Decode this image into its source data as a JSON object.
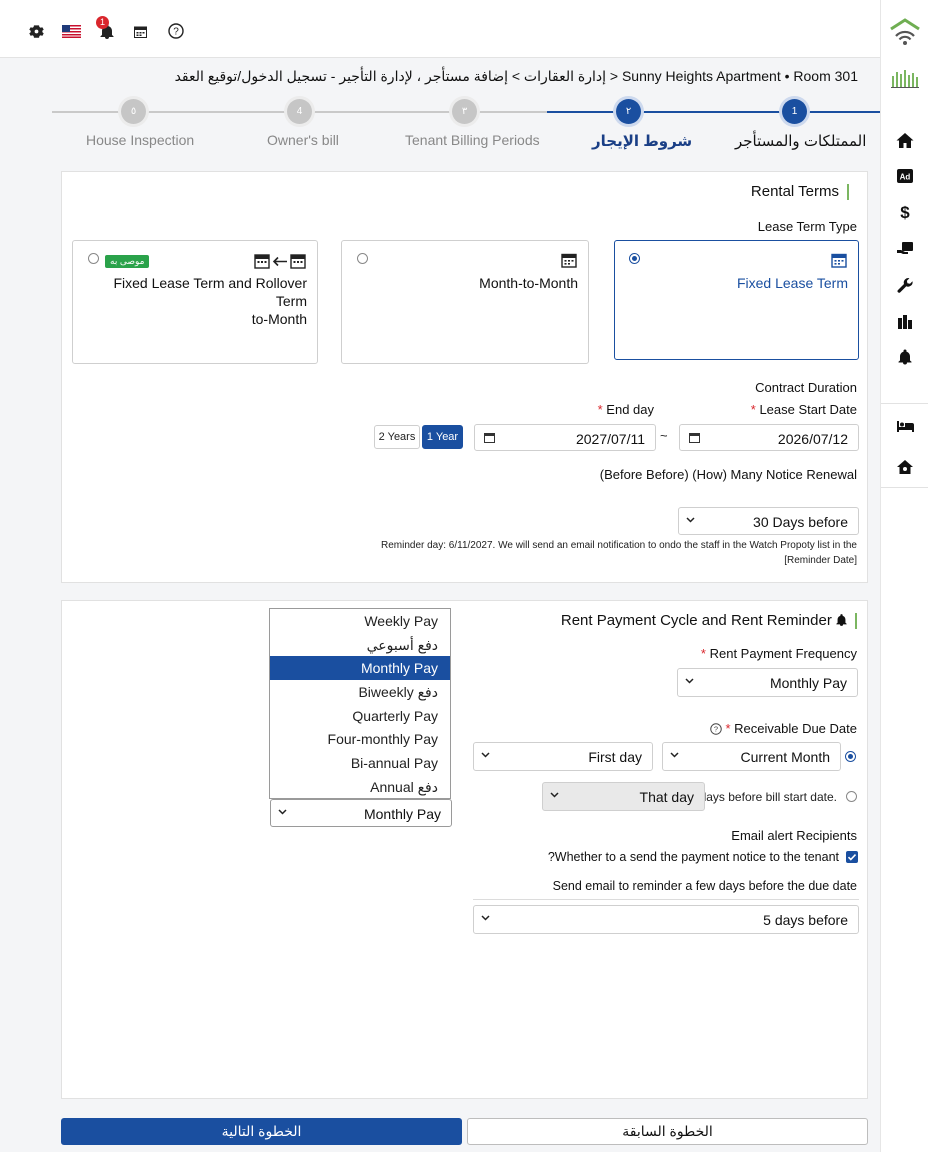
{
  "topbar": {
    "notification_count": "1",
    "icons": [
      "gear-icon",
      "us-flag-icon",
      "bell-icon",
      "calendar-icon",
      "help-icon"
    ]
  },
  "breadcrumb": "Sunny Heights Apartment • Room 301 < إدارة العقارات > إضافة مستأجر ، لإدارة التأجير - تسجيل الدخول/توقيع العقد",
  "stepper": {
    "steps": [
      {
        "number": "1",
        "label": "الممتلكات والمستأجر",
        "state": "done"
      },
      {
        "number": "٢",
        "label": "شروط الإيجار",
        "state": "current"
      },
      {
        "number": "٣",
        "label": "Tenant Billing Periods",
        "state": "todo"
      },
      {
        "number": "4",
        "label": "Owner's bill",
        "state": "todo"
      },
      {
        "number": "٥",
        "label": "House Inspection",
        "state": "todo"
      }
    ]
  },
  "rental_terms": {
    "title": "Rental Terms",
    "lease_type_label": "Lease Term Type",
    "options": [
      {
        "label": "Fixed Lease Term",
        "selected": true
      },
      {
        "label": "Month-to-Month",
        "selected": false
      },
      {
        "label": "Fixed Lease Term and Rollover Term-to-Month",
        "line1": "Fixed Lease Term and Rollover Term",
        "line2": "to-Month",
        "badge": "موصى به",
        "selected": false
      }
    ],
    "contract_duration_label": "Contract Duration",
    "start_label": "Lease Start Date",
    "end_label": "End day",
    "start_date": "2026/07/12",
    "end_date": "2027/07/11",
    "date_separator": "~",
    "duration_buttons": [
      {
        "label": "1 Year",
        "active": true
      },
      {
        "label": "2 Years",
        "active": false
      }
    ],
    "notice_label": "(Before Before) (How) Many Notice Renewal",
    "notice_value": "30 Days before",
    "reminder_note_line1": "Reminder day: 6/11/2027. We will send an email notification to ondo the staff in the Watch Propoty list in the",
    "reminder_note_line2": "[Reminder Date]"
  },
  "rent_payment": {
    "title": "Rent Payment Cycle and Rent Reminder",
    "frequency_label": "Rent Payment Frequency",
    "frequency_value": "Monthly Pay",
    "due_date_label": "Receivable Due Date",
    "due_month_value": "Current Month",
    "due_day_value": "First day",
    "alt_value": "That day",
    "alt_suffix": "days before bill start date.",
    "email_recipients_label": "Email alert Recipients",
    "send_notice_label": "?Whether to a send the payment notice to the tenant",
    "send_notice_checked": true,
    "reminder_days_label": "Send email to reminder a few days before the due date",
    "reminder_days_value": "5 days before",
    "dropdown_items": [
      "Weekly Pay",
      "دفع أسبوعي",
      "Monthly Pay",
      "Biweekly دفع",
      "Quarterly Pay",
      "Four-monthly Pay",
      "Bi-annual Pay",
      "Annual دفع"
    ],
    "dropdown_selected_index": 2,
    "dropdown_select_value": "Monthly Pay"
  },
  "footer": {
    "next_label": "الخطوة التالية",
    "prev_label": "الخطوة السابقة"
  },
  "colors": {
    "primary": "#1a4fa0",
    "accent_green": "#7bb661",
    "badge_red": "#d9262c"
  }
}
